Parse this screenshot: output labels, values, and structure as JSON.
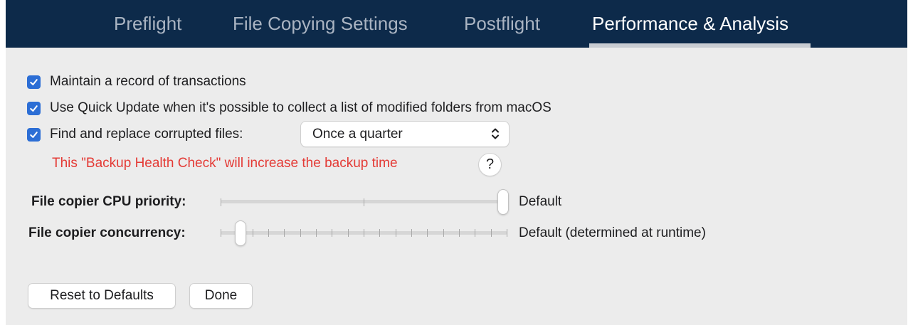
{
  "tabs": [
    {
      "label": "Preflight",
      "active": false
    },
    {
      "label": "File Copying Settings",
      "active": false
    },
    {
      "label": "Postflight",
      "active": false
    },
    {
      "label": "Performance & Analysis",
      "active": true
    }
  ],
  "options": {
    "record_transactions": {
      "label": "Maintain a record of transactions",
      "checked": true
    },
    "quick_update": {
      "label": "Use Quick Update when it's possible to collect a list of modified folders from macOS",
      "checked": true
    },
    "find_replace": {
      "label": "Find and replace corrupted files:",
      "checked": true,
      "frequency": "Once a quarter"
    }
  },
  "warning": {
    "text": "This \"Backup Health Check\" will increase the backup time",
    "help_label": "?"
  },
  "sliders": {
    "cpu_priority": {
      "label": "File copier CPU priority:",
      "value_text": "Default",
      "level": 1.0
    },
    "concurrency": {
      "label": "File copier concurrency:",
      "value_text": "Default (determined at runtime)",
      "level": 0.0
    }
  },
  "buttons": {
    "reset": "Reset to Defaults",
    "done": "Done"
  },
  "colors": {
    "tab_bar": "#0d2a4a",
    "checkbox": "#2c6ed5",
    "warning": "#e43a35",
    "panel": "#ececec"
  }
}
